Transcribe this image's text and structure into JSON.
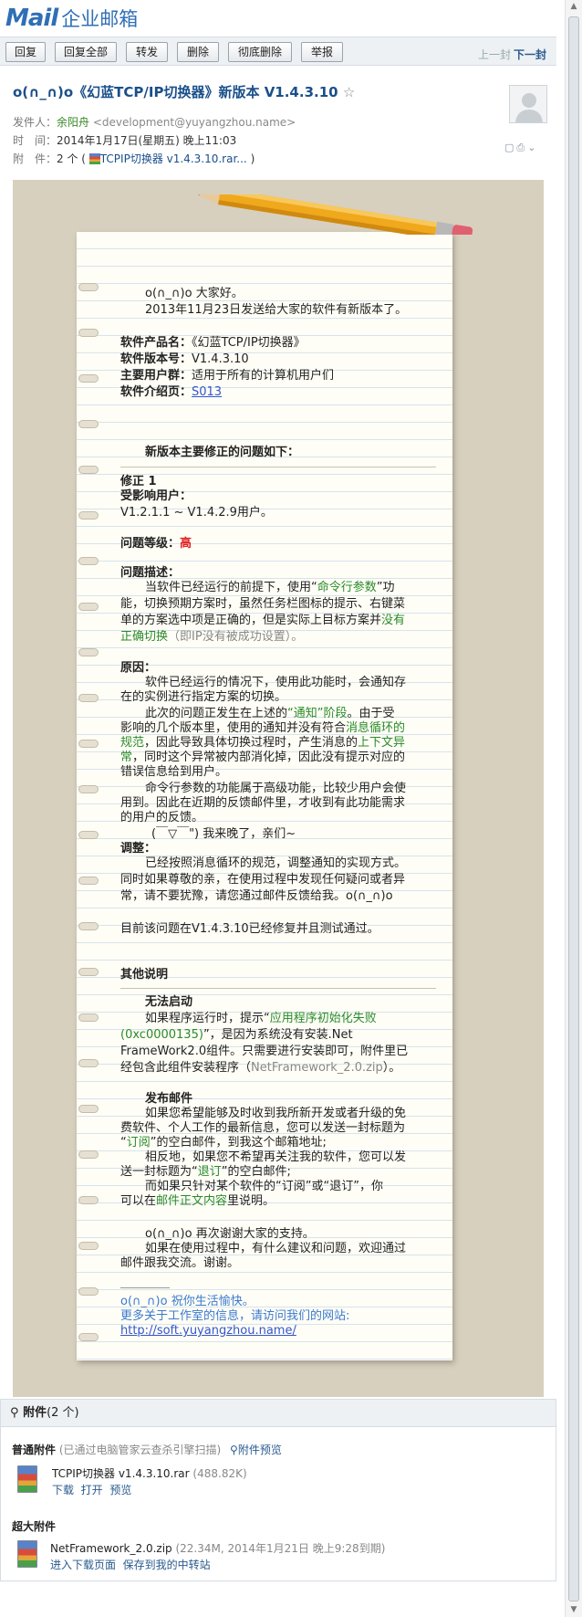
{
  "logo": {
    "mail_text": "Mail",
    "cn_text": "企业邮箱"
  },
  "toolbar": {
    "buttons": [
      "回复",
      "回复全部",
      "转发",
      "删除",
      "彻底删除",
      "举报"
    ],
    "prev_label": "上一封",
    "next_label": "下一封"
  },
  "mail": {
    "subject": "o(∩_∩)o《幻蓝TCP/IP切换器》新版本 V1.4.3.10",
    "star": "☆",
    "sender_label": "发件人：",
    "sender_name": "余阳舟",
    "sender_email": "<development@yuyangzhou.name>",
    "time_label": "时　间：",
    "time_value": "2014年1月17日(星期五) 晚上11:03",
    "attach_label": "附　件：",
    "attach_count": "2 个 (",
    "attach_name": "TCPIP切换器 v1.4.3.10.rar...",
    "attach_close": ")"
  },
  "body": {
    "greet1": "o(∩_∩)o  大家好。",
    "greet2": "2013年11月23日发送给大家的软件有新版本了。",
    "prod_label": "软件产品名：",
    "prod_value": "《幻蓝TCP/IP切换器》",
    "ver_label": "软件版本号：",
    "ver_value": "V1.4.3.10",
    "user_label": "主要用户群：",
    "user_value": "适用于所有的计算机用户们",
    "page_label": "软件介绍页：",
    "page_link": "S013",
    "fix_heading": "新版本主要修正的问题如下：",
    "fix1": "修正 1",
    "affect_label": "受影响用户：",
    "affect_value": "V1.2.1.1 ~ V1.4.2.9用户。",
    "level_label": "问题等级：",
    "level_value": "高",
    "desc_label": "问题描述：",
    "desc_a": "当软件已经运行的前提下，使用“",
    "desc_b": "命令行参数",
    "desc_c": "”功",
    "desc_line2": "能，切换预期方案时，虽然任务栏图标的提示、右键菜",
    "desc_line3a": "单的方案选中项是正确的，但是实际上目标方案并",
    "desc_line3b": "没有",
    "desc_line4a": "正确切换",
    "desc_line4b": "（即IP没有被成功设置）。",
    "cause_label": "原因：",
    "cause1": "软件已经运行的情况下，使用此功能时，会通知存",
    "cause1b": "在的实例进行指定方案的切换。",
    "cause2a": "此次的问题正发生在上述的",
    "cause2b": "“通知”阶段",
    "cause2c": "。由于受",
    "cause3a": "影响的几个版本里，使用的通知并没有符合",
    "cause3b": "消息循环的",
    "cause4a": "规范",
    "cause4b": "，因此导致具体切换过程时，产生消息的",
    "cause4c": "上下文异",
    "cause5a": "常",
    "cause5b": "，同时这个异常被内部消化掉，因此没有提示对应的",
    "cause6": "错误信息给到用户。",
    "cause7": "命令行参数的功能属于高级功能，比较少用户会使",
    "cause8": "用到。因此在近期的反馈邮件里，才收到有此功能需求",
    "cause9": "的用户的反馈。",
    "cause10": "(￣▽￣\") 我来晚了，亲们~",
    "adjust_label": "调整：",
    "adjust1": "已经按照消息循环的规范，调整通知的实现方式。",
    "adjust2": "同时如果尊敬的亲，在使用过程中发现任何疑问或者异",
    "adjust3": "常，请不要犹豫，请您通过邮件反馈给我。o(∩_∩)o",
    "fixed": "目前该问题在V1.4.3.10已经修复并且测试通过。",
    "other_heading": "其他说明",
    "nostart_title": "无法启动",
    "nostart1a": "如果程序运行时，提示“",
    "nostart1b": "应用程序初始化失败",
    "nostart2a": "(0xc0000135)",
    "nostart2b": "”，是因为系统没有安装.Net",
    "nostart3": "FrameWork2.0组件。只需要进行安装即可，附件里已",
    "nostart4a": "经包含此组件安装程序（",
    "nostart4b": "NetFramework_2.0.zip",
    "nostart4c": "）。",
    "pub_title": "发布邮件",
    "pub1": "如果您希望能够及时收到我所新开发或者升级的免",
    "pub2": "费软件、个人工作的最新信息，您可以发送一封标题为",
    "pub3a": "“",
    "pub3b": "订阅",
    "pub3c": "”的空白邮件，到我这个邮箱地址;",
    "pub4": "相反地，如果您不希望再关注我的软件，您可以发",
    "pub5a": "送一封标题为“",
    "pub5b": "退订",
    "pub5c": "”的空白邮件;",
    "pub6": "而如果只针对某个软件的“订阅”或“退订”，你",
    "pub7a": "可以在",
    "pub7b": "邮件正文内容",
    "pub7c": "里说明。",
    "thanks1": "o(∩_∩)o 再次谢谢大家的支持。",
    "thanks2": "如果在使用过程中，有什么建议和问题，欢迎通过",
    "thanks3": "邮件跟我交流。谢谢。",
    "sig1": "o(∩_∩)o  祝你生活愉快。",
    "sig2": "更多关于工作室的信息，请访问我们的网站:",
    "sig3": "http://soft.yuyangzhou.name/"
  },
  "attachments": {
    "title": "附件",
    "count": "(2 个)",
    "normal_label": "普通附件",
    "normal_note": "(已通过电脑管家云查杀引擎扫描)",
    "preview": "附件预览",
    "file1_name": "TCPIP切换器 v1.4.3.10.rar",
    "file1_size": "(488.82K)",
    "file1_actions": [
      "下载",
      "打开",
      "预览"
    ],
    "big_label": "超大附件",
    "file2_name": "NetFramework_2.0.zip",
    "file2_meta": "(22.34M, 2014年1月21日 晚上9:28到期)",
    "file2_actions": [
      "进入下载页面",
      "保存到我的中转站"
    ]
  }
}
